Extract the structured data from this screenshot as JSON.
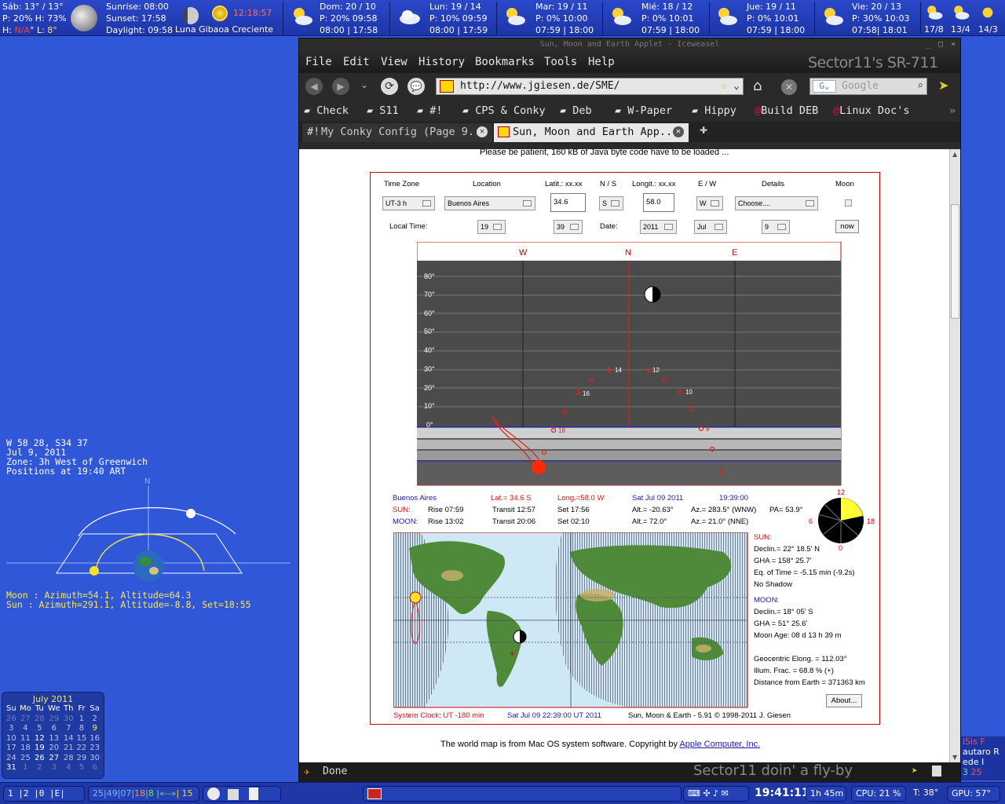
{
  "topbar": {
    "today": {
      "line1": "Sáb: 13° / 13°",
      "line2": "P: 20% H: 73%",
      "line3_h": "H: ",
      "line3_na": "N/A",
      "line3_l": "° L: ",
      "line3_lv": "8°"
    },
    "sun": {
      "sunrise": "Sunrise: 08:00",
      "sunset": "Sunset: 17:58",
      "daylight": "Daylight: 09:58"
    },
    "moon": {
      "phase": "Luna Gibaoa Creciente",
      "clock": "12:18:57"
    },
    "forecast": [
      {
        "day": "Dom: 20 / 10",
        "precip": "P: 20% 09:58",
        "times": "08:00 | 17:58"
      },
      {
        "day": "Lun: 19 / 14",
        "precip": "P: 10% 09:59",
        "times": "08:00 | 17:59"
      },
      {
        "day": "Mar: 19 / 11",
        "precip": "P: 0% 10:00",
        "times": "07:59 | 18:00"
      },
      {
        "day": "Mié: 18 / 12",
        "precip": "P: 0% 10:01",
        "times": "07:59 | 18:00"
      },
      {
        "day": "Jue: 19 / 11",
        "precip": "P: 0% 10:01",
        "times": "07:59 | 18:00"
      },
      {
        "day": "Vie: 20 / 13",
        "precip": "P: 30% 10:03",
        "times": "07:58| 18:01"
      }
    ],
    "mini": [
      "17/8",
      "13/4",
      "14/3"
    ]
  },
  "leftpanel": {
    "lines": [
      "W 58 28, S34 37",
      "Jul 9, 2011",
      "Zone:  3h West of Greenwich",
      "Positions at 19:40 ART"
    ],
    "north": "N",
    "moon_line": "Moon : Azimuth=54.1, Altitude=64.3",
    "sun_line": "Sun  : Azimuth=291.1, Altitude=-8.8, Set=18:55"
  },
  "calendar": {
    "title": "July 2011",
    "headers": [
      "Su",
      "Mo",
      "Tu",
      "We",
      "Th",
      "Fr",
      "Sa"
    ],
    "rows": [
      [
        "26",
        "27",
        "28",
        "29",
        "30",
        "1",
        "2"
      ],
      [
        "3",
        "4",
        "5",
        "6",
        "7",
        "8",
        "9"
      ],
      [
        "10",
        "11",
        "12",
        "13",
        "14",
        "15",
        "16"
      ],
      [
        "17",
        "18",
        "19",
        "20",
        "21",
        "22",
        "23"
      ],
      [
        "24",
        "25",
        "26",
        "27",
        "28",
        "29",
        "30"
      ],
      [
        "31",
        "1",
        "2",
        "3",
        "4",
        "5",
        "6"
      ]
    ]
  },
  "browser": {
    "title": "Sun, Moon and Earth Applet - Iceweasel",
    "menus": [
      "File",
      "Edit",
      "View",
      "History",
      "Bookmarks",
      "Tools",
      "Help"
    ],
    "brand": "Sector11's SR-711",
    "url": "http://www.jgiesen.de/SME/",
    "search_placeholder": "Google",
    "bookmarks": [
      "Check",
      "S11",
      "#!",
      "CPS & Conky",
      "Deb",
      "W-Paper",
      "Hippy",
      "Build DEB",
      "Linux Doc's"
    ],
    "tabs": [
      "My Conky Config (Page 9...",
      "Sun, Moon and Earth App..."
    ],
    "notice": "Please be patient, 160 kB of Java byte code have to be loaded ...",
    "status": "Done",
    "status_brand": "Sector11 doin' a fly-by",
    "footer_text": "The world map is from Mac OS system software. Copyright by ",
    "footer_link": "Apple Computer, Inc."
  },
  "applet": {
    "headers": {
      "tz": "Time Zone",
      "loc": "Location",
      "lat": "Latit.: xx.xx",
      "ns": "N / S",
      "lon": "Longit.: xx.xx",
      "ew": "E / W",
      "details": "Details",
      "moon": "Moon"
    },
    "values": {
      "tz": "UT-3 h",
      "loc": "Buenos Aires",
      "lat": "34.6",
      "ns": "S",
      "lon": "58.0",
      "ew": "W",
      "details": "Choose...."
    },
    "localtime": {
      "label": "Local Time:",
      "hour": "19",
      "min": "39",
      "date_label": "Date:",
      "year": "2011",
      "month": "Jul",
      "day": "9",
      "now": "now"
    },
    "compass": [
      "W",
      "N",
      "E"
    ],
    "alt_ticks": [
      "80°",
      "70°",
      "60°",
      "50°",
      "40°",
      "30°",
      "20°",
      "10°",
      "0°"
    ],
    "sun_hours": [
      "14",
      "12",
      "16",
      "10",
      "18",
      "8"
    ],
    "info": {
      "place": "Buenos Aires",
      "lat": "Lat.= 34.6 S",
      "lon": "Long.=58.0 W",
      "date": "Sat Jul 09  2011",
      "time": "19:39:00",
      "sun": "SUN:",
      "sun_rise": "Rise     07:59",
      "sun_transit": "Transit  12:57",
      "sun_set": "Set      17:56",
      "sun_alt": "Alt.= -20.63°",
      "sun_az": "Az.= 283.5° (WNW)",
      "pa": "PA= 53.9°",
      "moon": "MOON:",
      "moon_rise": "Rise     13:02",
      "moon_transit": "Transit  20:06",
      "moon_set": "Set      02:10",
      "moon_alt": "Alt.= 72.0°",
      "moon_az": "Az.= 21.0° (NNE)"
    },
    "dial": {
      "top": "12",
      "left": "6",
      "right": "18",
      "bottom": "0"
    },
    "right": {
      "sun": "SUN:",
      "sun_decl": "Declin.= 22° 18.5' N",
      "sun_gha": "GHA    = 158° 25.7'",
      "eqtime": "Eq. of Time = -5.15 min  (-9.2s)",
      "shadow": "No Shadow",
      "moon": "MOON:",
      "moon_decl": "Declin.= 18° 05' S",
      "moon_gha": "GHA    = 51° 25.6'",
      "moon_age": "Moon Age: 08 d 13 h 39 m",
      "elong": "Geocentric Elong. = 112.03°",
      "illum": "Illum. Frac. = 68.8 % (+)",
      "dist": "Distance from Earth = 371363 km",
      "about": "About..."
    },
    "footer": {
      "clock": "System Clock: UT -180 min",
      "utc": "Sat Jul 09 22:39:00 UT 2011",
      "credit": "Sun, Moon & Earth - 5.91  © 1998-2011 J. Giesen"
    }
  },
  "bottombar": {
    "workspaces": "1  |2  |0   |E|",
    "stats_a": "25|49|07|",
    "stats_b": "18",
    "stats_c": "|8 |",
    "stats_d": "«--»",
    "stats_e": "| 15",
    "clock": "19:41:11",
    "uptime": "1h 45m",
    "cpu": "CPU: 21 %",
    "temp": "T: 38°",
    "gpu": "GPU: 57°"
  },
  "rightwidget": {
    "l1": "lSis F",
    "l2": "autaro R",
    "l3": "ede I",
    "l4a": "3",
    "l4b": "25"
  }
}
